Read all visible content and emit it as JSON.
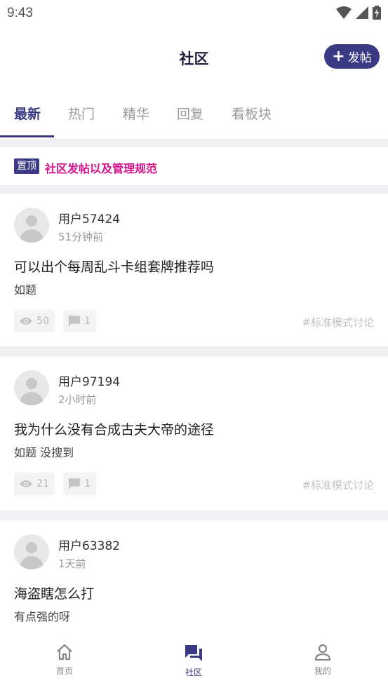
{
  "status_bar": {
    "time": "9:43"
  },
  "header": {
    "title": "社区",
    "post_button": {
      "icon": "plus-icon",
      "label": "发帖"
    }
  },
  "tabs": [
    {
      "label": "最新",
      "active": true
    },
    {
      "label": "热门",
      "active": false
    },
    {
      "label": "精华",
      "active": false
    },
    {
      "label": "回复",
      "active": false
    },
    {
      "label": "看板块",
      "active": false
    }
  ],
  "pinned": {
    "badge": "置顶",
    "title": "社区发帖以及管理规范"
  },
  "posts": [
    {
      "user": "用户57424",
      "time": "51分钟前",
      "title": "可以出个每周乱斗卡组套牌推荐吗",
      "excerpt": "如题",
      "views": "50",
      "comments": "1",
      "tag": "#标准模式讨论"
    },
    {
      "user": "用户97194",
      "time": "2小时前",
      "title": "我为什么没有合成古夫大帝的途径",
      "excerpt": "如题 没搜到",
      "views": "21",
      "comments": "1",
      "tag": "#标准模式讨论"
    },
    {
      "user": "用户63382",
      "time": "1天前",
      "title": "海盗瞎怎么打",
      "excerpt": "有点强的呀"
    }
  ],
  "bottom_nav": [
    {
      "label": "首页",
      "icon": "home-icon",
      "active": false
    },
    {
      "label": "社区",
      "icon": "chat-bubbles-icon",
      "active": true
    },
    {
      "label": "我的",
      "icon": "person-icon",
      "active": false
    }
  ],
  "colors": {
    "accent": "#3b3a84",
    "pinned_title": "#d4138e",
    "divider": "#f1f1f5"
  }
}
